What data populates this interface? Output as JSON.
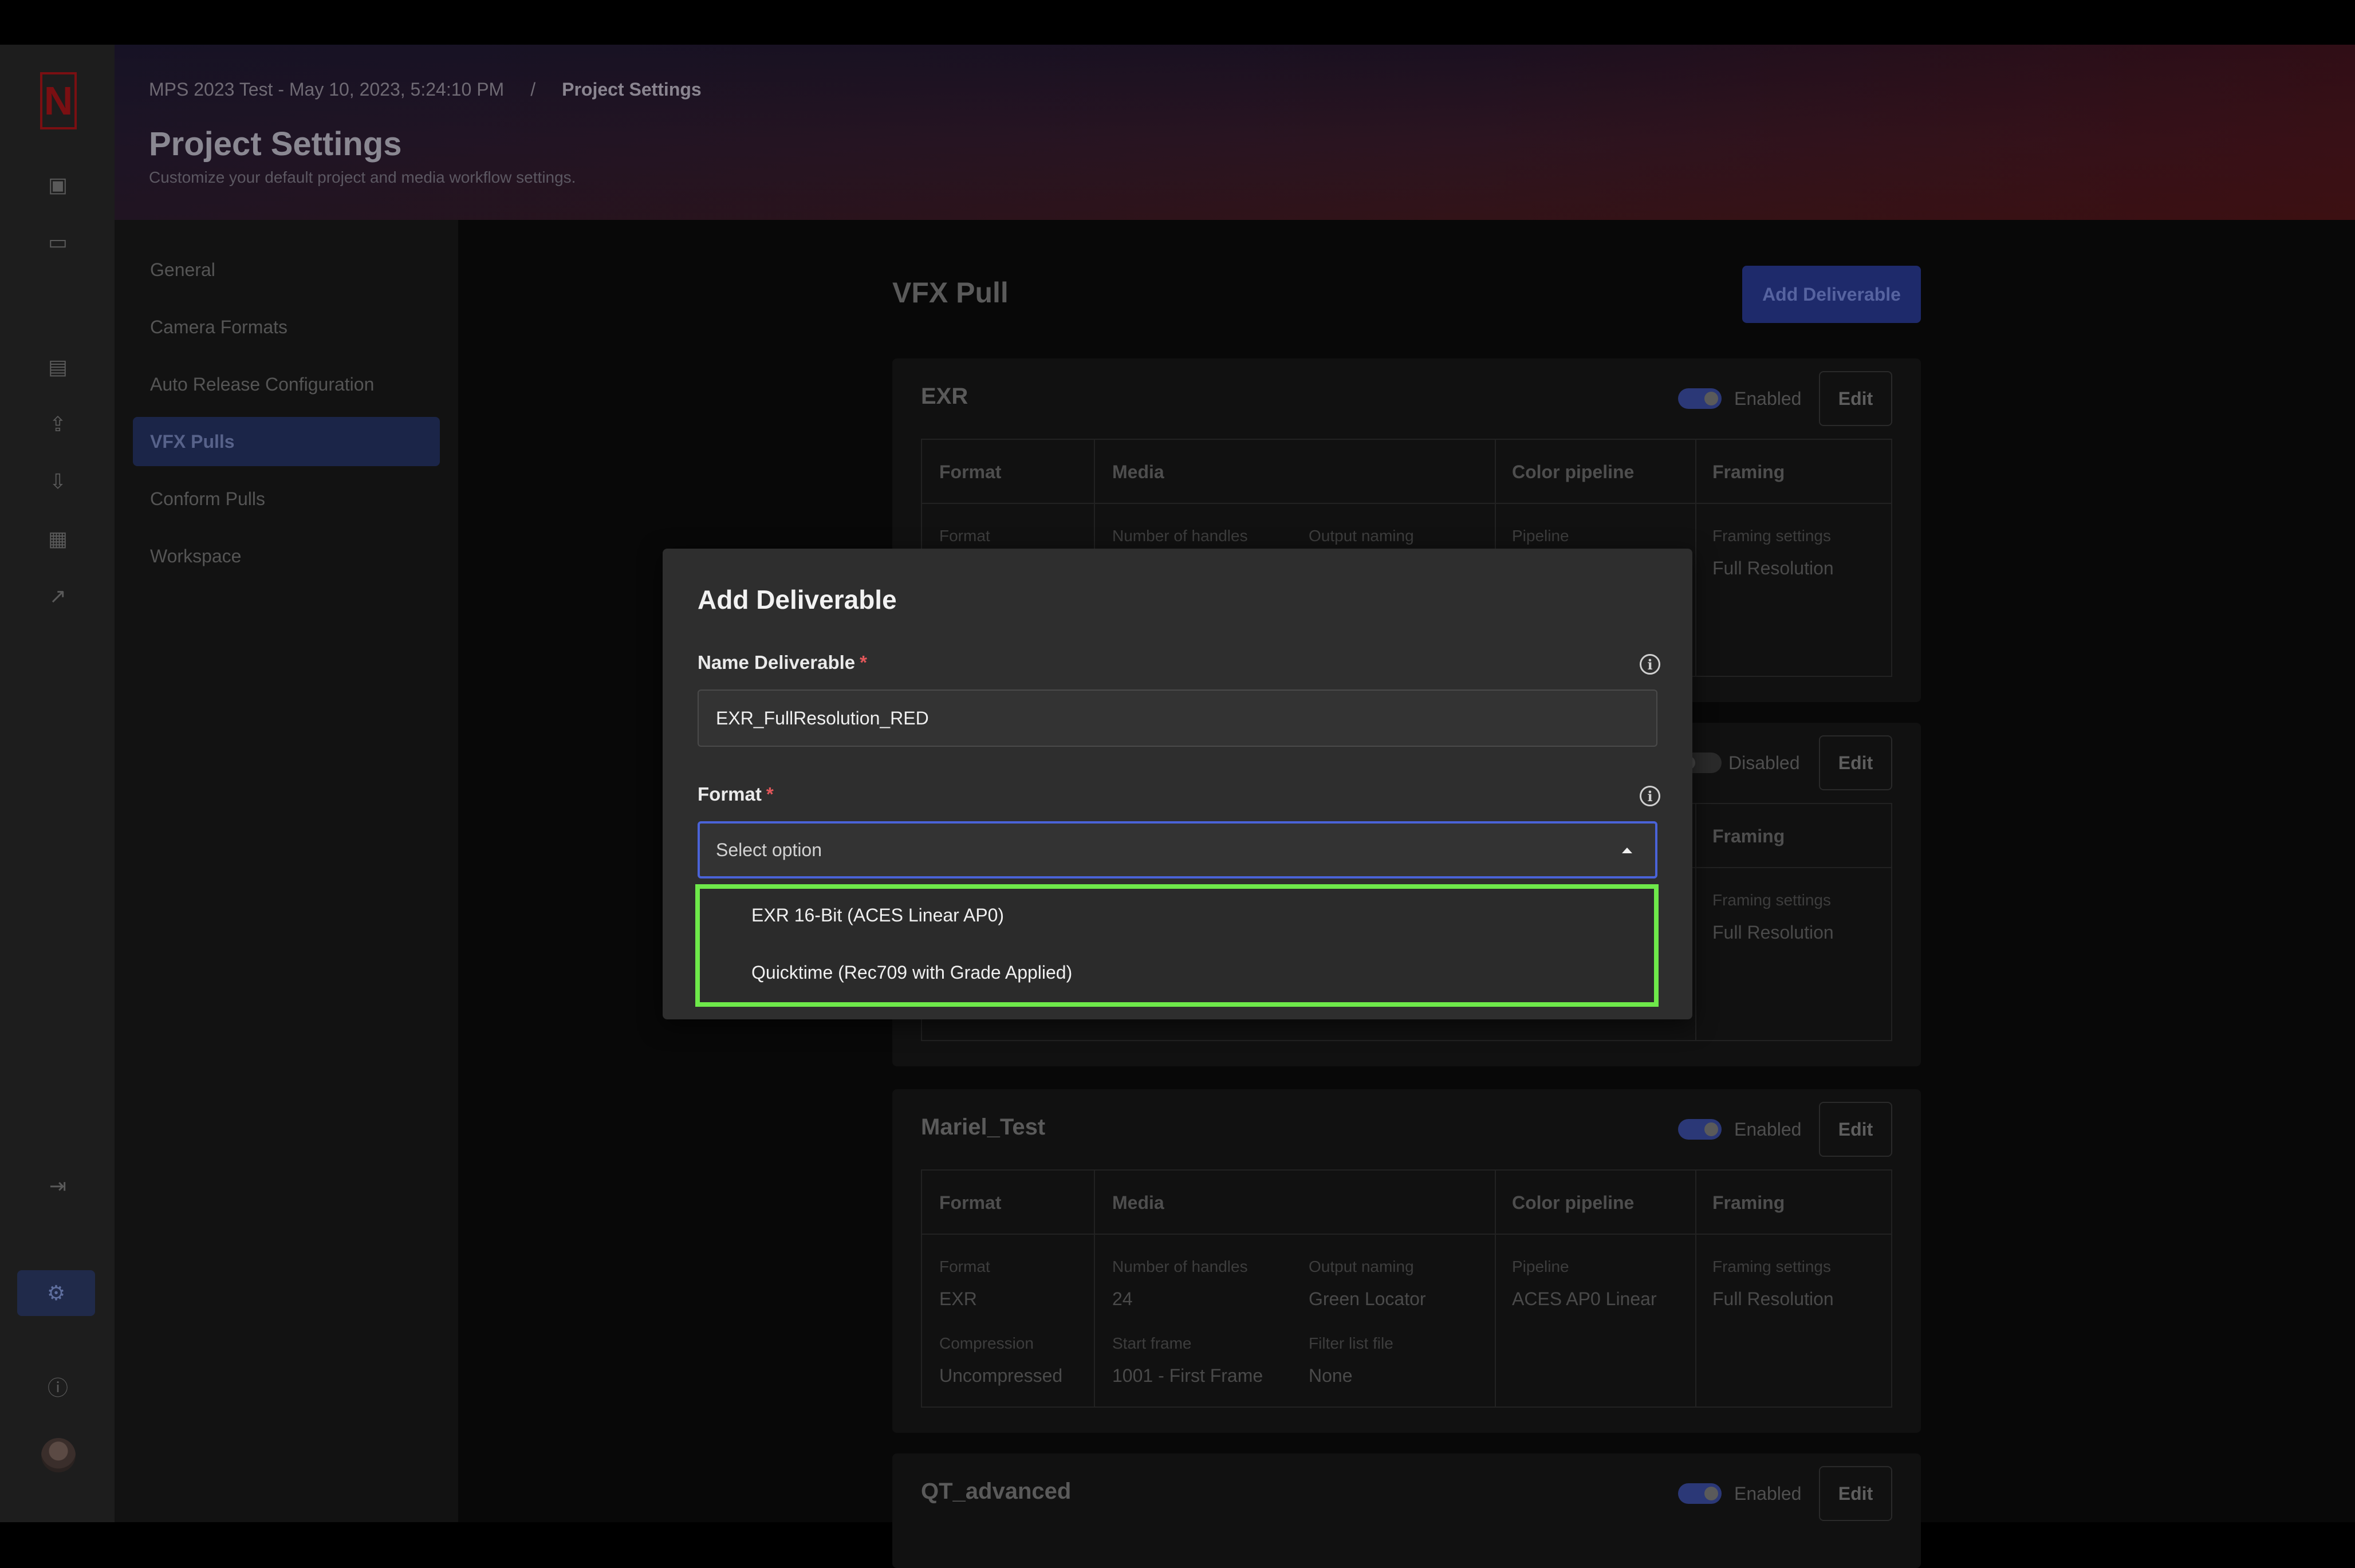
{
  "header": {
    "breadcrumb_project": "MPS 2023 Test - May 10, 2023, 5:24:10 PM",
    "breadcrumb_sep": "/",
    "breadcrumb_current": "Project Settings",
    "title": "Project Settings",
    "subtitle": "Customize your default project and media workflow settings."
  },
  "settings_nav": {
    "items": [
      {
        "label": "General"
      },
      {
        "label": "Camera Formats"
      },
      {
        "label": "Auto Release Configuration"
      },
      {
        "label": "VFX Pulls"
      },
      {
        "label": "Conform Pulls"
      },
      {
        "label": "Workspace"
      }
    ],
    "active": "VFX Pulls"
  },
  "main": {
    "title": "VFX Pull",
    "add_button": "Add Deliverable",
    "cards": [
      {
        "name": "EXR",
        "status": "Enabled",
        "edit": "Edit",
        "columns": [
          "Format",
          "Media",
          "Color pipeline",
          "Framing"
        ],
        "labels": [
          "Format",
          "Number of handles",
          "Output naming",
          "Pipeline",
          "Framing settings"
        ],
        "framing_value": "Full Resolution"
      },
      {
        "name": "",
        "status": "Disabled",
        "edit": "Edit",
        "columns_visible": [
          "Framing"
        ],
        "framing_label": "Framing settings",
        "framing_value": "Full Resolution"
      },
      {
        "name": "Mariel_Test",
        "status": "Enabled",
        "edit": "Edit",
        "columns": [
          "Format",
          "Media",
          "Color pipeline",
          "Framing"
        ],
        "fields": {
          "format_label": "Format",
          "format_value": "EXR",
          "compression_label": "Compression",
          "compression_value": "Uncompressed",
          "handles_label": "Number of handles",
          "handles_value": "24",
          "start_label": "Start frame",
          "start_value": "1001 - First Frame",
          "naming_label": "Output naming",
          "naming_value": "Green Locator",
          "filter_label": "Filter list file",
          "filter_value": "None",
          "pipeline_label": "Pipeline",
          "pipeline_value": "ACES AP0 Linear",
          "framing_label": "Framing settings",
          "framing_value": "Full Resolution"
        }
      },
      {
        "name": "QT_advanced",
        "status": "Enabled",
        "edit": "Edit"
      }
    ]
  },
  "modal": {
    "title": "Add Deliverable",
    "name_label": "Name Deliverable",
    "required_mark": "*",
    "name_value": "EXR_FullResolution_RED",
    "format_label": "Format",
    "format_placeholder": "Select option",
    "options": [
      "EXR 16-Bit (ACES Linear AP0)",
      "Quicktime (Rec709 with Grade Applied)"
    ]
  },
  "icons": {
    "info": "i",
    "logo": "N"
  },
  "colors": {
    "accent": "#4a63d8",
    "highlight": "#6ee94a",
    "required": "#e2575a"
  }
}
